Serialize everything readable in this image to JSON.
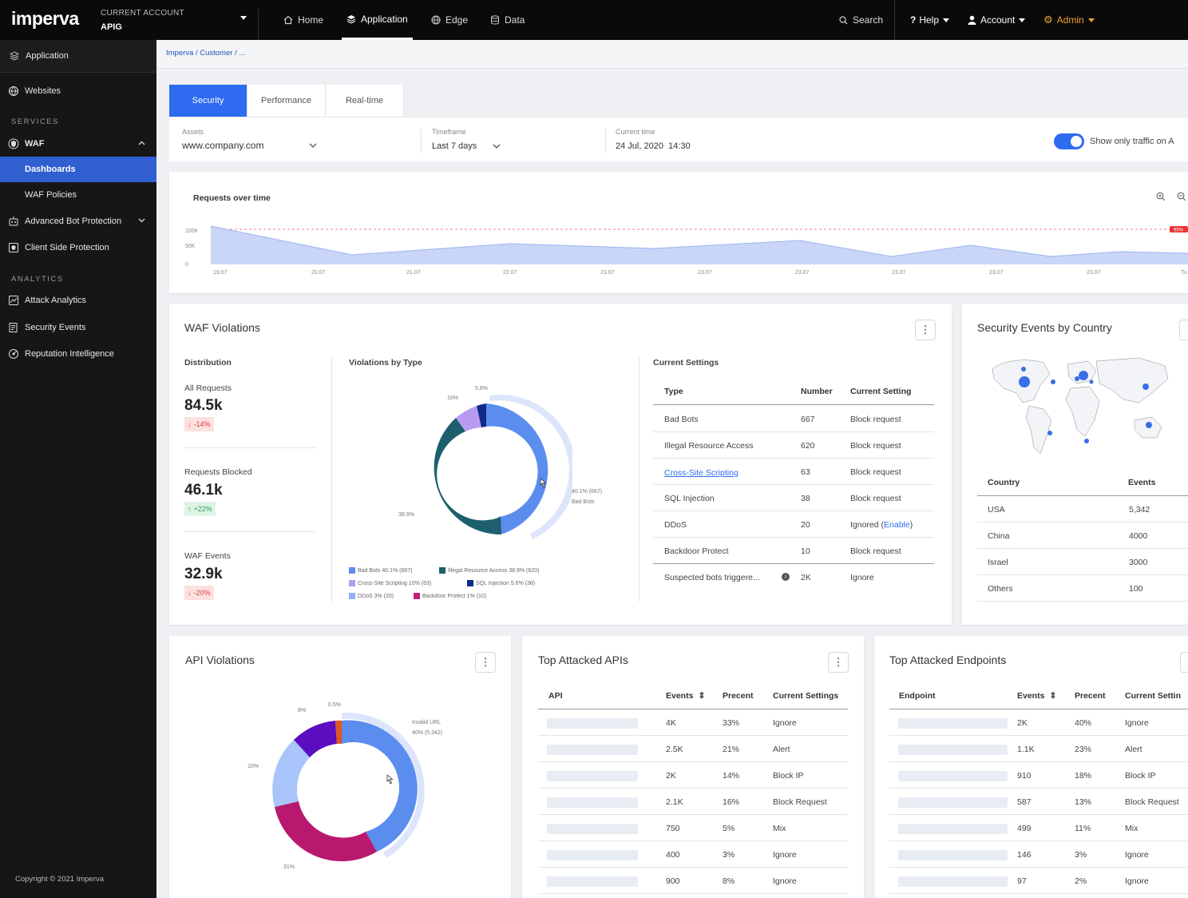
{
  "topbar": {
    "logo": "imperva",
    "account_label": "CURRENT ACCOUNT",
    "account_name": "APIG",
    "nav": [
      "Home",
      "Application",
      "Edge",
      "Data"
    ],
    "search": "Search",
    "help": "Help",
    "account": "Account",
    "admin": "Admin",
    "accent": "#f0a030"
  },
  "sidebar": {
    "app": "Application",
    "websites": "Websites",
    "services_label": "SERVICES",
    "waf": "WAF",
    "dashboards": "Dashboards",
    "waf_policies": "WAF Policies",
    "bot": "Advanced Bot Protection",
    "client_side": "Client Side Protection",
    "analytics_label": "ANALYTICS",
    "attack_analytics": "Attack Analytics",
    "security_events": "Security Events",
    "reputation": "Reputation Intelligence",
    "copyright": "Copyright © 2021 Imperva"
  },
  "breadcrumb": "Imperva / Customer / ...",
  "tabs": [
    "Security",
    "Performance",
    "Real-time"
  ],
  "filters": {
    "assets_label": "Assets",
    "assets_value": "www.company.com",
    "timeframe_label": "Timeframe",
    "timeframe_value": "Last 7 days",
    "current_time_label": "Current time",
    "current_time_value": "24 Jul, 2020  14:30",
    "toggle_text": "Show only traffic on A"
  },
  "requests_chart": {
    "title": "Requests over time",
    "y_ticks": [
      "100K",
      "50K",
      "0"
    ],
    "x_ticks": [
      "19.07",
      "20.07",
      "21.07",
      "22.07",
      "23.07",
      "23.07",
      "23.07",
      "23.07",
      "23.07",
      "23.07",
      "Tu"
    ],
    "threshold_badge": "95%",
    "fill_color": "#c9d6f8"
  },
  "waf": {
    "title": "WAF Violations",
    "distribution_label": "Distribution",
    "stats": [
      {
        "label": "All Requests",
        "value": "84.5k",
        "change": "-14%",
        "dir": "down"
      },
      {
        "label": "Requests Blocked",
        "value": "46.1k",
        "change": "+22%",
        "dir": "up"
      },
      {
        "label": "WAF Events",
        "value": "32.9k",
        "change": "-20%",
        "dir": "down"
      }
    ],
    "violations_label": "Violations by Type",
    "donut_labels": {
      "l1": "5.6%",
      "l2": "10%",
      "l3": "38.9%",
      "l4": "40.1% (667)",
      "l5": "Bad Bots"
    },
    "legend": [
      {
        "text": "Bad Bots 40.1% (667)",
        "color": "#5b8def"
      },
      {
        "text": "Illegal Resource Access 38.9% (620)",
        "color": "#1e5f6e"
      },
      {
        "text": "Cross-Site Scripting 10% (63)",
        "color": "#b89af0"
      },
      {
        "text": "SQL Injection 5.6% (38)",
        "color": "#0e2a8a"
      },
      {
        "text": "DDoS 3% (20)",
        "color": "#8eb0f5"
      },
      {
        "text": "Backdoor Protect 1% (10)",
        "color": "#c21d78"
      }
    ],
    "settings_label": "Current Settings",
    "headers": [
      "Type",
      "Number",
      "Current Setting"
    ],
    "rows": [
      {
        "type": "Bad Bots",
        "number": "667",
        "setting": "Block request"
      },
      {
        "type": "Illegal Resource Access",
        "number": "620",
        "setting": "Block request"
      },
      {
        "type": "Cross-Site Scripting",
        "number": "63",
        "setting": "Block request"
      },
      {
        "type": "SQL Injection",
        "number": "38",
        "setting": "Block request"
      },
      {
        "type": "DDoS",
        "number": "20",
        "setting": "Ignored (",
        "link": "Enable",
        "tail": ")"
      },
      {
        "type": "Backdoor Protect",
        "number": "10",
        "setting": "Block request"
      },
      {
        "type": "Suspected bots triggere...",
        "number": "2K",
        "setting": "Ignore"
      }
    ]
  },
  "country": {
    "title": "Security Events by Country",
    "headers": [
      "Country",
      "Events"
    ],
    "rows": [
      {
        "country": "USA",
        "events": "5,342"
      },
      {
        "country": "China",
        "events": "4000"
      },
      {
        "country": "Israel",
        "events": "3000"
      },
      {
        "country": "Others",
        "events": "100"
      }
    ]
  },
  "api_violations": {
    "title": "API Violations",
    "labels": {
      "a": "0.5%",
      "b": "8%",
      "c": "10%",
      "d": "31%",
      "e1": "Invalid URL",
      "e2": "40% (5,342)"
    }
  },
  "top_apis": {
    "title": "Top Attacked APIs",
    "headers": [
      "API",
      "Events",
      "Precent",
      "Current Settings"
    ],
    "rows": [
      {
        "events": "4K",
        "pct": "33%",
        "setting": "Ignore"
      },
      {
        "events": "2.5K",
        "pct": "21%",
        "setting": "Alert"
      },
      {
        "events": "2K",
        "pct": "14%",
        "setting": "Block IP"
      },
      {
        "events": "2.1K",
        "pct": "16%",
        "setting": "Block Request"
      },
      {
        "events": "750",
        "pct": "5%",
        "setting": "Mix"
      },
      {
        "events": "400",
        "pct": "3%",
        "setting": "Ignore"
      },
      {
        "events": "900",
        "pct": "8%",
        "setting": "Ignore"
      }
    ]
  },
  "top_endpoints": {
    "title": "Top Attacked Endpoints",
    "headers": [
      "Endpoint",
      "Events",
      "Precent",
      "Current Settin"
    ],
    "rows": [
      {
        "events": "2K",
        "pct": "40%",
        "setting": "Ignore"
      },
      {
        "events": "1.1K",
        "pct": "23%",
        "setting": "Alert"
      },
      {
        "events": "910",
        "pct": "18%",
        "setting": "Block IP"
      },
      {
        "events": "587",
        "pct": "13%",
        "setting": "Block Request"
      },
      {
        "events": "499",
        "pct": "11%",
        "setting": "Mix"
      },
      {
        "events": "146",
        "pct": "3%",
        "setting": "Ignore"
      },
      {
        "events": "97",
        "pct": "2%",
        "setting": "Ignore"
      }
    ]
  }
}
